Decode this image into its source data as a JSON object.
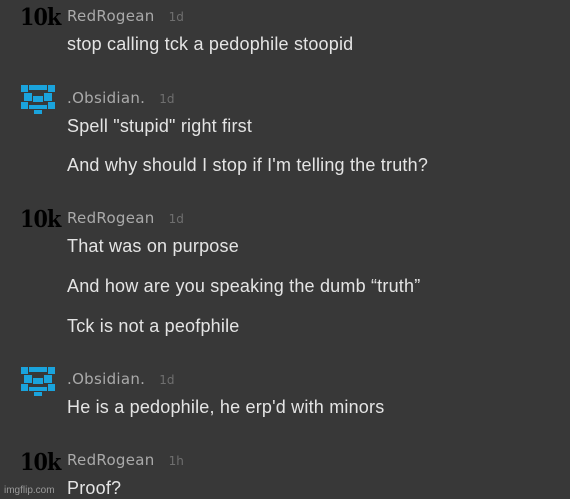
{
  "thread": {
    "comments": [
      {
        "user": "RedRogean",
        "time": "1d",
        "avatar": "10k",
        "lines": [
          "stop calling tck a pedophile stoopid"
        ]
      },
      {
        "user": ".Obsidian.",
        "time": "1d",
        "avatar_icon": "pixel-face-icon",
        "lines": [
          "Spell \"stupid\" right first",
          "And why should I stop if I'm telling the truth?"
        ]
      },
      {
        "user": "RedRogean",
        "time": "1d",
        "avatar": "10k",
        "lines": [
          "That was on purpose",
          "And how are you speaking the dumb “truth”",
          "Tck is not a peofphile"
        ]
      },
      {
        "user": ".Obsidian.",
        "time": "1d",
        "avatar_icon": "pixel-face-icon",
        "lines": [
          "He is a pedophile, he erp'd with minors"
        ]
      },
      {
        "user": "RedRogean",
        "time": "1h",
        "avatar": "10k",
        "lines": [
          "Proof?"
        ]
      }
    ]
  },
  "colors": {
    "background": "#383838",
    "avatar_blue": "#1aa3dc",
    "username": "#aaaaaa",
    "timestamp": "#6f6f6f",
    "message": "#e4e4e4"
  },
  "watermark": "imgflip.com"
}
